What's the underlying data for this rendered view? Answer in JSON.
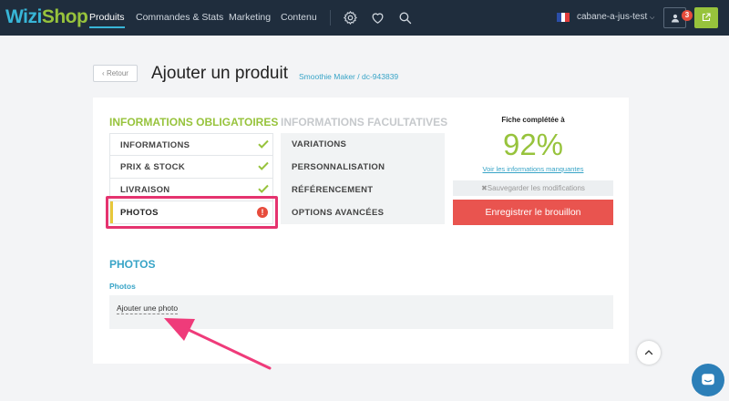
{
  "nav": {
    "logo_part1": "Wizi",
    "logo_part2": "Shop",
    "items": [
      "Produits",
      "Commandes & Stats",
      "Marketing",
      "Contenu"
    ],
    "icons": [
      "gear-icon",
      "heart-icon",
      "search-icon"
    ],
    "store_name": "cabane-a-jus-test",
    "notification_count": "3"
  },
  "header": {
    "back_label": "Retour",
    "title": "Ajouter un produit",
    "subtitle": "Smoothie Maker / dc-943839"
  },
  "required": {
    "title": "INFORMATIONS OBLIGATOIRES",
    "items": [
      {
        "label": "INFORMATIONS",
        "status": "complete"
      },
      {
        "label": "PRIX & STOCK",
        "status": "complete"
      },
      {
        "label": "LIVRAISON",
        "status": "complete"
      },
      {
        "label": "PHOTOS",
        "status": "error",
        "error_glyph": "!"
      }
    ]
  },
  "optional": {
    "title": "INFORMATIONS FACULTATIVES",
    "items": [
      "VARIATIONS",
      "PERSONNALISATION",
      "RÉFÉRENCEMENT",
      "OPTIONS AVANCÉES"
    ]
  },
  "completion": {
    "label": "Fiche complétée à",
    "value": "92%",
    "missing_link": "Voir les informations manquantes",
    "save_modifications": "Sauvegarder les modifications",
    "draft_button": "Enregistrer le brouillon"
  },
  "photos": {
    "section_title": "PHOTOS",
    "field_label": "Photos",
    "add_link": "Ajouter une photo"
  },
  "colors": {
    "nav_bg": "#1f2d3d",
    "accent_blue": "#38b6d8",
    "accent_green": "#97c33c",
    "danger": "#e9544f",
    "highlight_pink": "#e5336f"
  }
}
